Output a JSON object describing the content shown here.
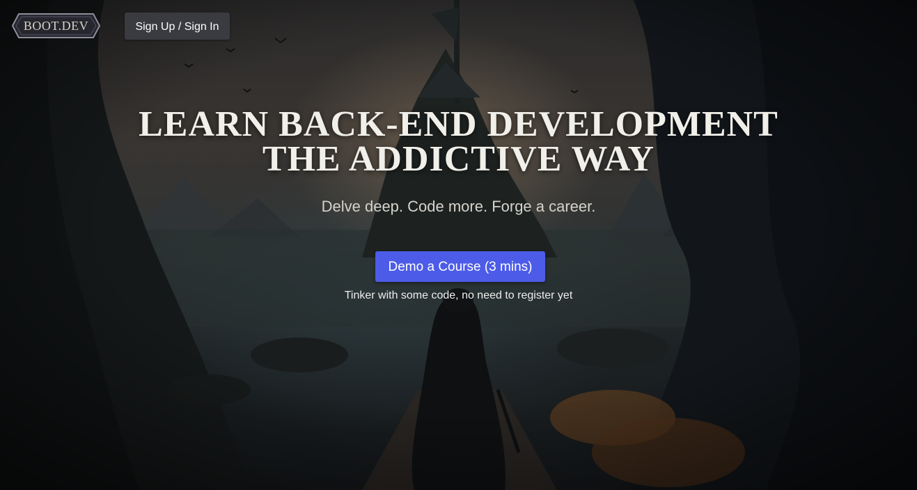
{
  "header": {
    "logo_text": "BOOT.DEV",
    "signin_label": "Sign Up / Sign In"
  },
  "hero": {
    "title_line1": "LEARN BACK-END DEVELOPMENT",
    "title_line2": "THE ADDICTIVE WAY",
    "subtitle": "Delve deep. Code more. Forge a career.",
    "cta_label": "Demo a Course (3 mins)",
    "cta_note": "Tinker with some code, no need to register yet"
  },
  "colors": {
    "cta": "#4c5ce8",
    "signin_bg": "#3a3b40"
  },
  "icons": [
    "boot-dev-logo"
  ]
}
